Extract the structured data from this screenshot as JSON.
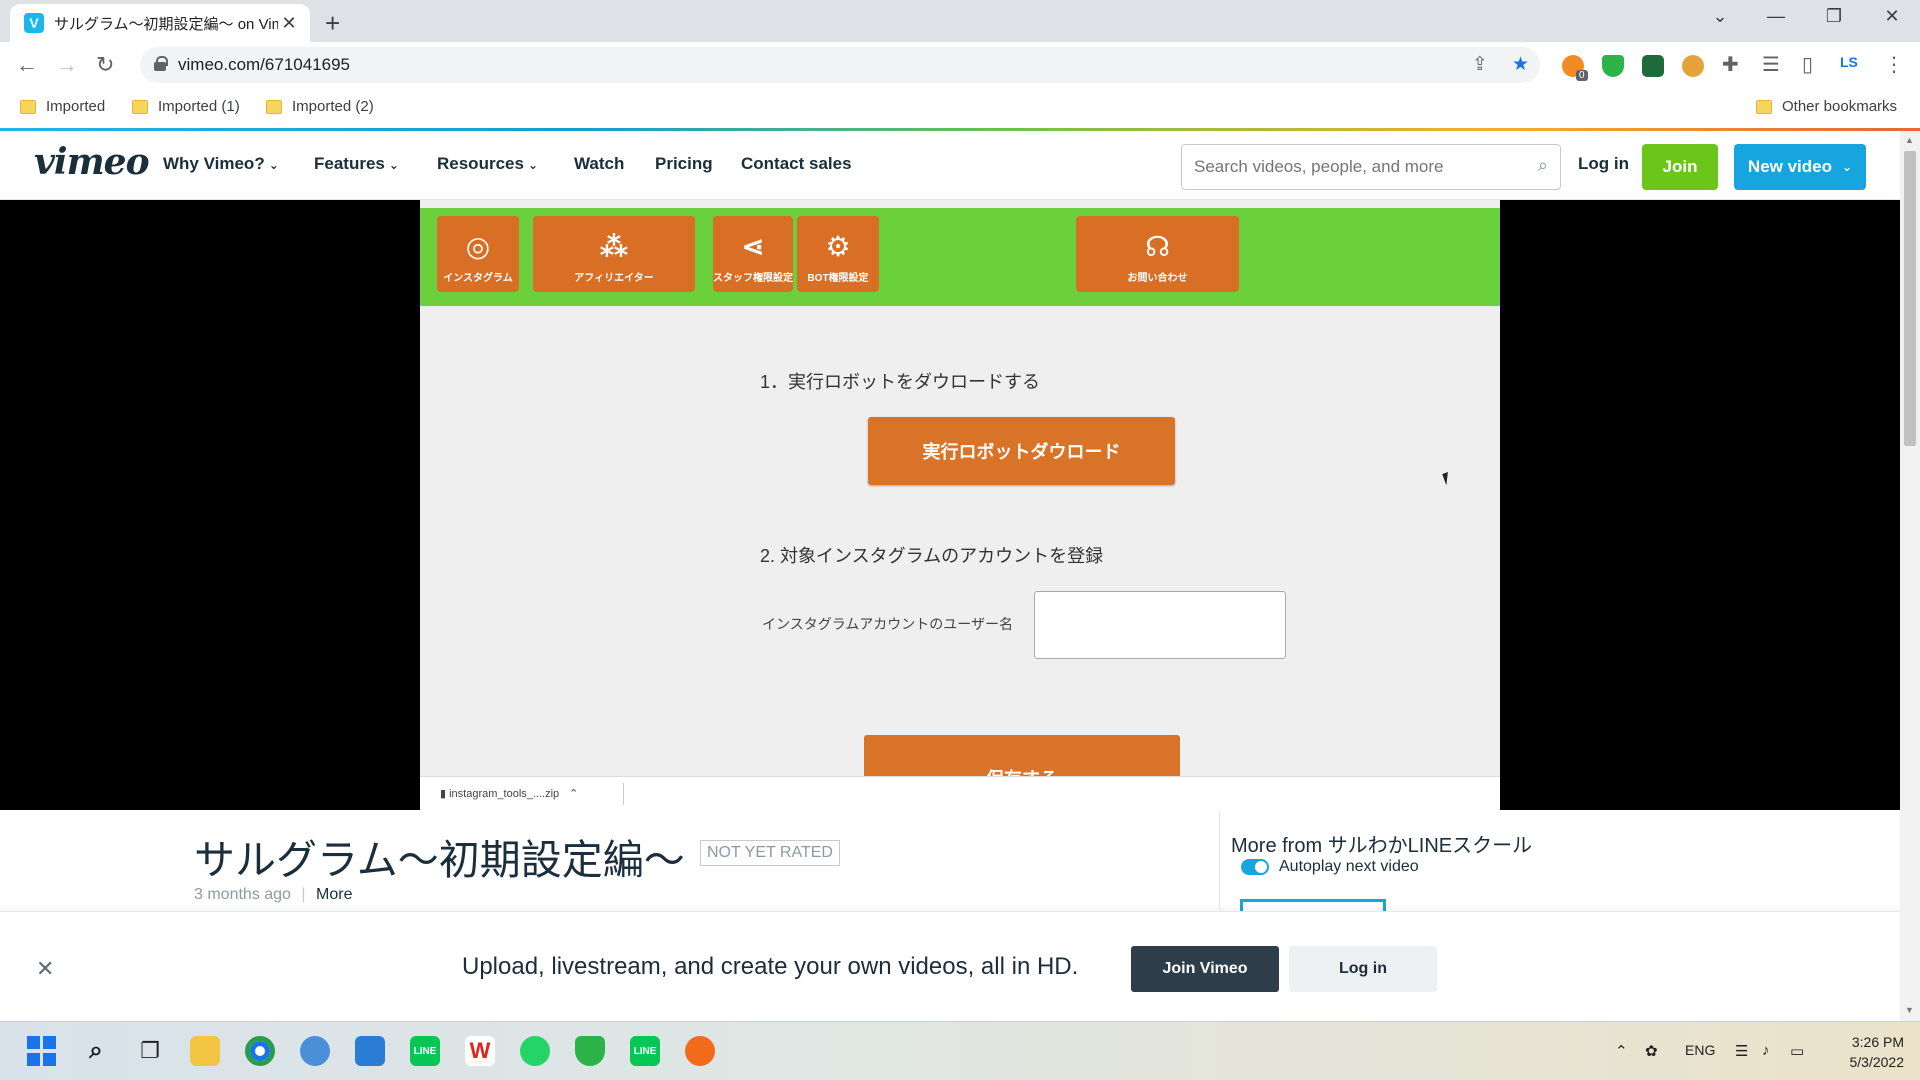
{
  "browser": {
    "tab_title": "サルグラム～初期設定編～ on Vimeo",
    "tab_favicon": "V",
    "new_tab": "+",
    "url": "vimeo.com/671041695",
    "bookmarks": [
      "Imported",
      "Imported (1)",
      "Imported (2)"
    ],
    "other_bookmarks": "Other bookmarks",
    "profile_initials": "LS",
    "extension_badge": "0"
  },
  "vimeo": {
    "logo": "vimeo",
    "nav": [
      "Why Vimeo?",
      "Features",
      "Resources",
      "Watch",
      "Pricing",
      "Contact sales"
    ],
    "search_placeholder": "Search videos, people, and more",
    "login": "Log in",
    "join": "Join",
    "new_video": "New video"
  },
  "video_frame": {
    "menu_buttons": [
      "インスタグラム",
      "アフィリエイター",
      "スタッフ権限設定",
      "BOT権限設定",
      "お問い合わせ"
    ],
    "step1": "1．実行ロボットをダウロードする",
    "download_button": "実行ロボットダウロード",
    "step2": "2. 対象インスタグラムのアカウントを登録",
    "field_label": "インスタグラムアカウントのユーザー名",
    "save_button": "保存する",
    "download_item": "instagram_tools_....zip"
  },
  "video_info": {
    "title": "サルグラム～初期設定編～",
    "rating": "NOT YET RATED",
    "age": "3 months ago",
    "more": "More",
    "more_from": "More from サルわかLINEスクール",
    "autoplay": "Autoplay next video"
  },
  "promo": {
    "text": "Upload, livestream, and create your own videos, all in HD.",
    "join": "Join Vimeo",
    "login": "Log in"
  },
  "taskbar": {
    "language": "ENG",
    "time": "3:26 PM",
    "date": "5/3/2022"
  },
  "colors": {
    "vimeo_blue": "#17a5e0",
    "vimeo_green": "#6cc51b",
    "frame_green": "#6ccf3c",
    "frame_orange": "#d87327"
  }
}
